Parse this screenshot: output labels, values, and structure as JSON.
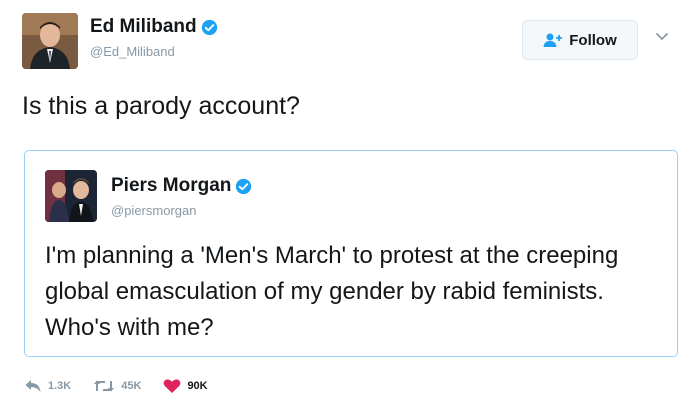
{
  "author": {
    "display_name": "Ed Miliband",
    "handle": "@Ed_Miliband",
    "verified": true
  },
  "follow_button": {
    "label": "Follow"
  },
  "tweet": {
    "text": "Is this a parody account?"
  },
  "quoted_tweet": {
    "display_name": "Piers Morgan",
    "handle": "@piersmorgan",
    "verified": true,
    "text": "I'm planning a 'Men's March' to protest at the creeping global emasculation of my gender by rabid feminists. Who's with me?"
  },
  "actions": {
    "reply_count": "1.3K",
    "retweet_count": "45K",
    "like_count": "90K"
  },
  "colors": {
    "verified_blue": "#1da1f2",
    "like_red": "#e0245e",
    "muted_gray": "#8899a6",
    "quote_border": "#9ad0f5"
  }
}
